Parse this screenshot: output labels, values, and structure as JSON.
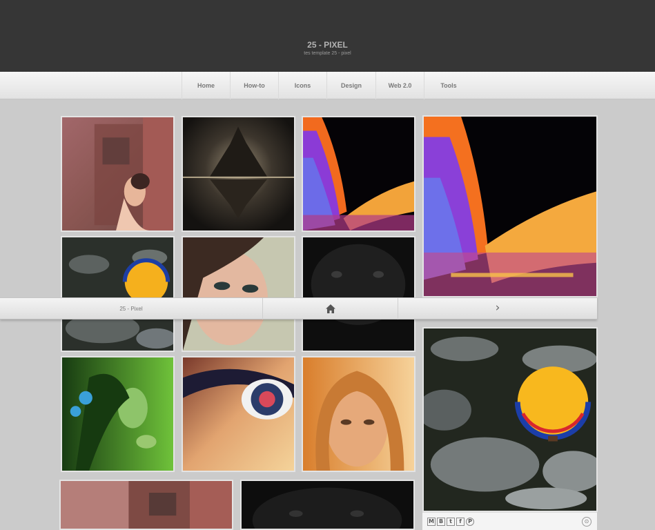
{
  "site": {
    "title": "25 - PIXEL",
    "description": "tes template 25 - pixel"
  },
  "nav": {
    "items": [
      "Home",
      "How-to",
      "Icons",
      "Design",
      "Web 2.0",
      "Tools"
    ]
  },
  "bottom_bar": {
    "label": "25 - Pixel",
    "home_icon": "home-icon",
    "next_icon": "chevron-right-icon",
    "next_glyph": "›"
  },
  "share": {
    "buttons": [
      "M",
      "B",
      "t",
      "f",
      "P"
    ],
    "more_glyph": "⊙"
  },
  "colors": {
    "header_bg": "#363636",
    "page_bg": "#cbcbcb",
    "nav_bg": "#ececec"
  }
}
